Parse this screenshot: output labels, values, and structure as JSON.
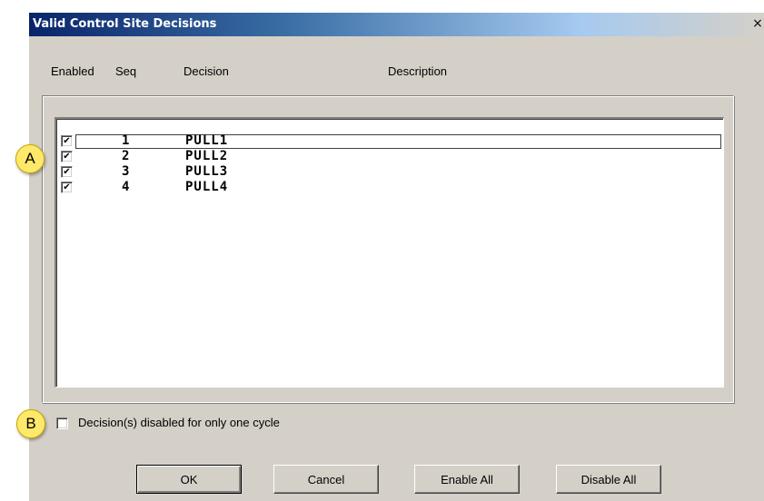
{
  "window": {
    "title": "Valid Control Site Decisions",
    "close_glyph": "×"
  },
  "columns": {
    "enabled": "Enabled",
    "seq": "Seq",
    "decision": "Decision",
    "description": "Description"
  },
  "rows": [
    {
      "enabled": true,
      "check": "✔",
      "seq": "1",
      "decision": "PULL1",
      "description": ""
    },
    {
      "enabled": true,
      "check": "✔",
      "seq": "2",
      "decision": "PULL2",
      "description": ""
    },
    {
      "enabled": true,
      "check": "✔",
      "seq": "3",
      "decision": "PULL3",
      "description": ""
    },
    {
      "enabled": true,
      "check": "✔",
      "seq": "4",
      "decision": "PULL4",
      "description": ""
    }
  ],
  "one_cycle": {
    "checked": false,
    "label": "Decision(s) disabled for only one cycle"
  },
  "buttons": {
    "ok": "OK",
    "cancel": "Cancel",
    "enable_all": "Enable All",
    "disable_all": "Disable All"
  },
  "callouts": {
    "a": "A",
    "b": "B"
  },
  "colors": {
    "dialog_bg": "#d4d0c8",
    "title_active": "#0a246a",
    "callout_fill": "#ffe96a"
  }
}
